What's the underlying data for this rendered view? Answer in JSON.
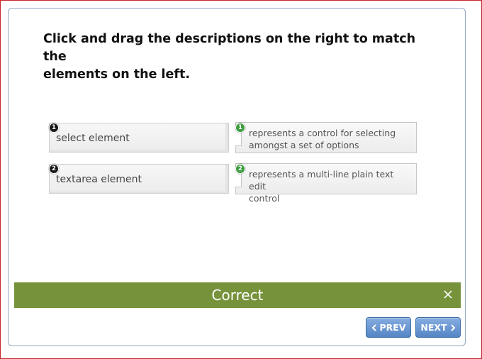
{
  "question": {
    "line1": "Click and drag the descriptions on the right to match the",
    "line2": "elements on the left."
  },
  "pairs": [
    {
      "number": "1",
      "term": "select element",
      "description_line1": "represents a control for selecting",
      "description_line2": "amongst a set of options"
    },
    {
      "number": "2",
      "term": "textarea element",
      "description_line1": "represents a multi-line plain text edit",
      "description_line2": "control"
    }
  ],
  "feedback": {
    "text": "Correct",
    "close_icon": "close-icon",
    "color": "#76923b"
  },
  "navigation": {
    "prev_label": "PREV",
    "next_label": "NEXT",
    "prev_icon": "chevron-left-icon",
    "next_icon": "chevron-right-icon",
    "button_color": "#5f8fcf"
  },
  "colors": {
    "term_badge": "#1a1a1a",
    "description_badge": "#3d9e3f",
    "frame_border": "#c8252b"
  }
}
